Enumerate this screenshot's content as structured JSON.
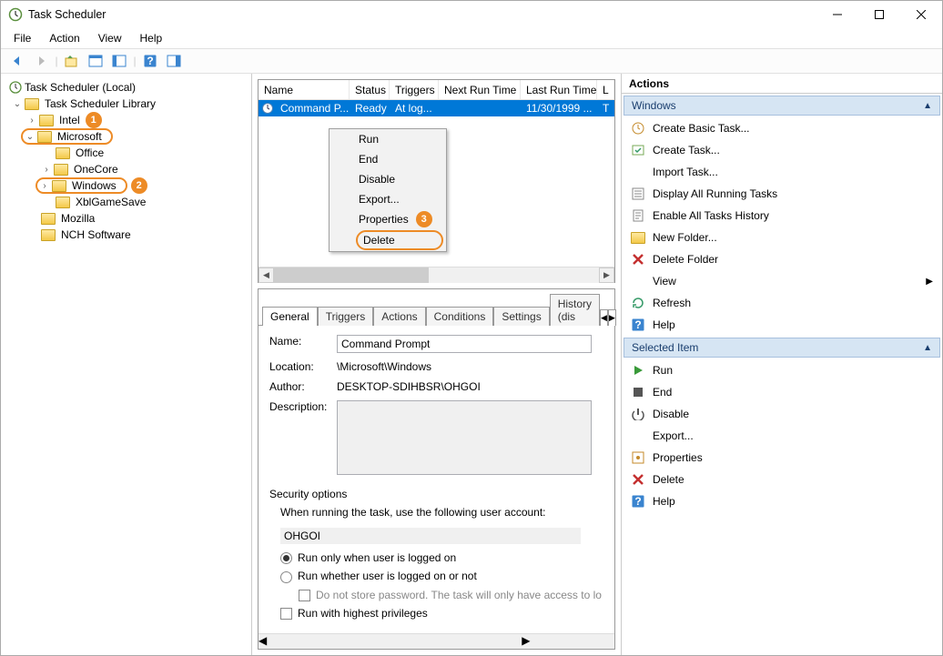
{
  "window": {
    "title": "Task Scheduler"
  },
  "menu": {
    "file": "File",
    "action": "Action",
    "view": "View",
    "help": "Help"
  },
  "tree": {
    "root": "Task Scheduler (Local)",
    "library": "Task Scheduler Library",
    "intel": "Intel",
    "microsoft": "Microsoft",
    "office": "Office",
    "onecore": "OneCore",
    "windows": "Windows",
    "xblgamesave": "XblGameSave",
    "mozilla": "Mozilla",
    "nch": "NCH Software"
  },
  "annotations": {
    "n1": "1",
    "n2": "2",
    "n3": "3"
  },
  "taskColumns": {
    "name": "Name",
    "status": "Status",
    "triggers": "Triggers",
    "nextRun": "Next Run Time",
    "lastRun": "Last Run Time",
    "last": "L"
  },
  "taskRow": {
    "name": "Command P...",
    "status": "Ready",
    "triggers": "At log...",
    "nextRun": "",
    "lastRun": "11/30/1999 ...",
    "last": "T"
  },
  "contextMenu": {
    "run": "Run",
    "end": "End",
    "disable": "Disable",
    "export": "Export...",
    "properties": "Properties",
    "delete": "Delete"
  },
  "tabs": {
    "general": "General",
    "triggers": "Triggers",
    "actions": "Actions",
    "conditions": "Conditions",
    "settings": "Settings",
    "history": "History (dis"
  },
  "general": {
    "nameLabel": "Name:",
    "nameValue": "Command Prompt",
    "locationLabel": "Location:",
    "locationValue": "\\Microsoft\\Windows",
    "authorLabel": "Author:",
    "authorValue": "DESKTOP-SDIHBSR\\OHGOI",
    "descLabel": "Description:",
    "secOptions": "Security options",
    "secText": "When running the task, use the following user account:",
    "userAccount": "OHGOI",
    "radio1": "Run only when user is logged on",
    "radio2": "Run whether user is logged on or not",
    "chkPw": "Do not store password.  The task will only have access to lo",
    "chkHigh": "Run with highest privileges"
  },
  "actionsPane": {
    "title": "Actions",
    "section1": "Windows",
    "createBasic": "Create Basic Task...",
    "createTask": "Create Task...",
    "importTask": "Import Task...",
    "displayAll": "Display All Running Tasks",
    "enableHistory": "Enable All Tasks History",
    "newFolder": "New Folder...",
    "deleteFolder": "Delete Folder",
    "view": "View",
    "refresh": "Refresh",
    "help": "Help",
    "section2": "Selected Item",
    "run": "Run",
    "end": "End",
    "disable": "Disable",
    "export": "Export...",
    "properties": "Properties",
    "delete": "Delete",
    "help2": "Help"
  }
}
